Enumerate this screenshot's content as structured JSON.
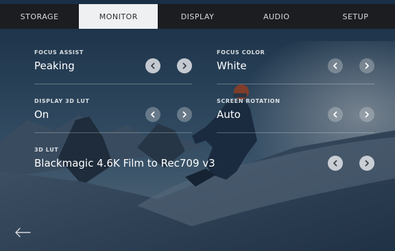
{
  "tabs": [
    {
      "label": "STORAGE",
      "active": false
    },
    {
      "label": "MONITOR",
      "active": true
    },
    {
      "label": "DISPLAY",
      "active": false
    },
    {
      "label": "AUDIO",
      "active": false
    },
    {
      "label": "SETUP",
      "active": false
    }
  ],
  "settings": {
    "focus_assist": {
      "label": "FOCUS ASSIST",
      "value": "Peaking"
    },
    "focus_color": {
      "label": "FOCUS COLOR",
      "value": "White"
    },
    "display_3d_lut": {
      "label": "DISPLAY 3D LUT",
      "value": "On"
    },
    "screen_rotation": {
      "label": "SCREEN ROTATION",
      "value": "Auto"
    },
    "lut_3d": {
      "label": "3D LUT",
      "value": "Blackmagic 4.6K Film to Rec709 v3"
    }
  },
  "icons": {
    "prev": "chevron-left-icon",
    "next": "chevron-right-icon",
    "back": "back-arrow-icon"
  },
  "colors": {
    "tab_bar": "#1b1d21",
    "active_tab": "#eef0f2",
    "arrow_button": "#e6e8eb"
  }
}
